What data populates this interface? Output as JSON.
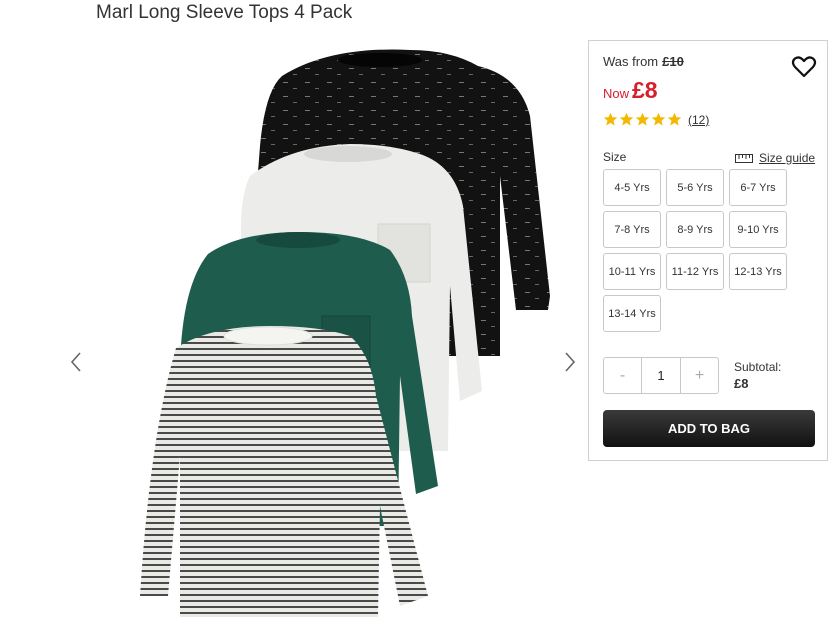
{
  "product": {
    "title": "Marl Long Sleeve Tops 4 Pack"
  },
  "gallery": {
    "prev_icon": "chevron-left-icon",
    "next_icon": "chevron-right-icon"
  },
  "pricing": {
    "was_label": "Was from",
    "was_price": "£10",
    "now_label": "Now",
    "now_price": "£8",
    "price_color": "#d81e2c"
  },
  "wishlist": {
    "icon": "heart-icon"
  },
  "rating": {
    "stars": 5,
    "star_color": "#f3b800",
    "review_count": "(12)"
  },
  "size": {
    "label": "Size",
    "guide_label": "Size guide",
    "options": [
      "4-5 Yrs",
      "5-6 Yrs",
      "6-7 Yrs",
      "7-8 Yrs",
      "8-9 Yrs",
      "9-10 Yrs",
      "10-11 Yrs",
      "11-12 Yrs",
      "12-13 Yrs",
      "13-14 Yrs"
    ]
  },
  "quantity": {
    "minus": "-",
    "value": "1",
    "plus": "+"
  },
  "subtotal": {
    "label": "Subtotal:",
    "value": "£8"
  },
  "cart": {
    "add_label": "ADD TO BAG"
  }
}
